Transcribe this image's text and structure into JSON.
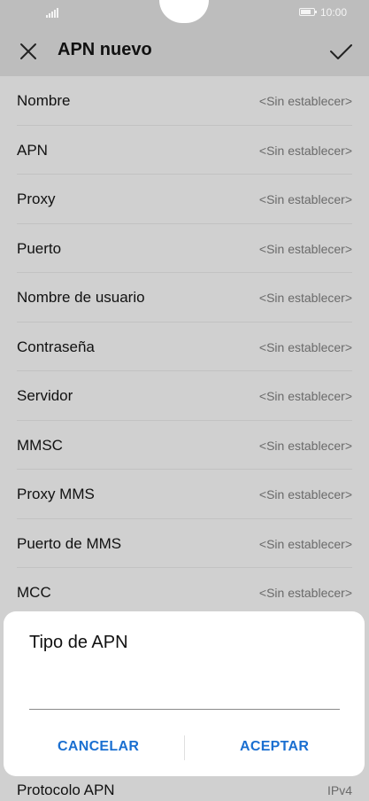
{
  "status_bar": {
    "time": "10:00",
    "battery_level": 0.8
  },
  "header": {
    "title": "APN nuevo",
    "close_icon": "close-icon",
    "confirm_icon": "check-icon"
  },
  "fields": [
    {
      "label": "Nombre",
      "value": "<Sin establecer>"
    },
    {
      "label": "APN",
      "value": "<Sin establecer>"
    },
    {
      "label": "Proxy",
      "value": "<Sin establecer>"
    },
    {
      "label": "Puerto",
      "value": "<Sin establecer>"
    },
    {
      "label": "Nombre de usuario",
      "value": "<Sin establecer>"
    },
    {
      "label": "Contraseña",
      "value": "<Sin establecer>"
    },
    {
      "label": "Servidor",
      "value": "<Sin establecer>"
    },
    {
      "label": "MMSC",
      "value": "<Sin establecer>"
    },
    {
      "label": "Proxy MMS",
      "value": "<Sin establecer>"
    },
    {
      "label": "Puerto de MMS",
      "value": "<Sin establecer>"
    },
    {
      "label": "MCC",
      "value": "<Sin establecer>"
    }
  ],
  "dialog": {
    "title": "Tipo de APN",
    "input_value": "",
    "cancel_label": "CANCELAR",
    "accept_label": "ACEPTAR"
  },
  "bottom_field": {
    "label": "Protocolo APN",
    "value": "IPv4"
  }
}
